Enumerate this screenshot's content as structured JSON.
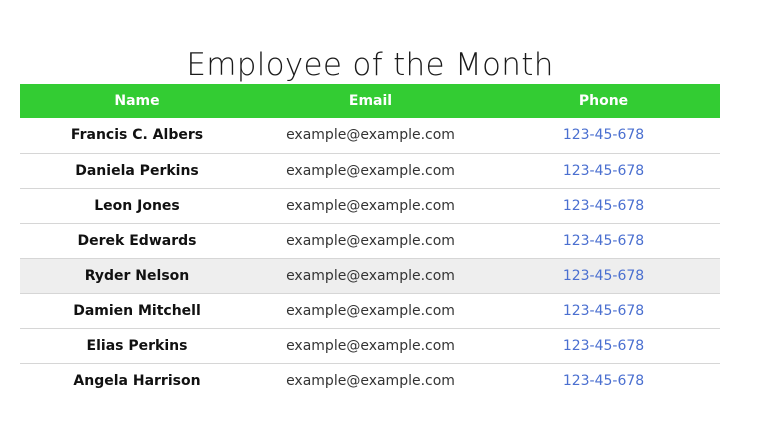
{
  "page": {
    "title": "Employee of the Month"
  },
  "table": {
    "header_bg": "#33cc33",
    "link_color": "#4a6fd0",
    "columns": [
      "Name",
      "Email",
      "Phone"
    ],
    "rows": [
      {
        "name": "Francis C. Albers",
        "email": "example@example.com",
        "phone": "123-45-678"
      },
      {
        "name": "Daniela Perkins",
        "email": "example@example.com",
        "phone": "123-45-678"
      },
      {
        "name": "Leon Jones",
        "email": "example@example.com",
        "phone": "123-45-678"
      },
      {
        "name": "Derek Edwards",
        "email": "example@example.com",
        "phone": "123-45-678"
      },
      {
        "name": "Ryder Nelson",
        "email": "example@example.com",
        "phone": "123-45-678",
        "highlighted": true
      },
      {
        "name": "Damien Mitchell",
        "email": "example@example.com",
        "phone": "123-45-678"
      },
      {
        "name": "Elias Perkins",
        "email": "example@example.com",
        "phone": "123-45-678"
      },
      {
        "name": "Angela Harrison",
        "email": "example@example.com",
        "phone": "123-45-678"
      }
    ]
  }
}
